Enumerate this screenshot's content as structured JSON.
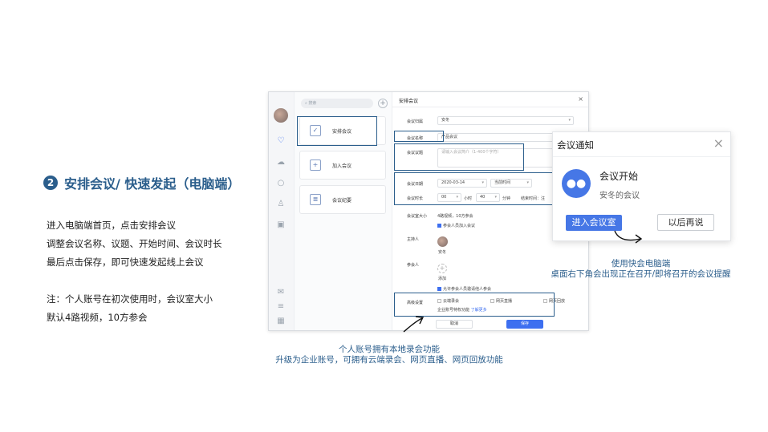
{
  "heading": {
    "number": "2",
    "title": "安排会议/ 快速发起（电脑端）"
  },
  "description": {
    "lines": [
      "进入电脑端首页，点击安排会议",
      "调整会议名称、议题、开始时间、会议时长",
      "最后点击保存，即可快速发起线上会议"
    ],
    "note_lines": [
      "注：个人账号在初次使用时，会议室大小",
      "默认4路视频，10方参会"
    ]
  },
  "app": {
    "search_placeholder": "搜索",
    "cards": [
      {
        "label": "安排会议",
        "icon": "check-calendar-icon"
      },
      {
        "label": "加入会议",
        "icon": "plus-icon"
      },
      {
        "label": "会议纪要",
        "icon": "document-icon"
      }
    ],
    "dialog": {
      "title": "安排会议",
      "close": "×",
      "fields": {
        "type_label": "会议归属",
        "type_value": "安冬",
        "name_label": "会议名称",
        "name_value": "产品会议",
        "topic_label": "会议议题",
        "topic_placeholder": "请输入会议简介（1-400个字符）",
        "date_label": "会议日期",
        "date_value": "2020-03-14",
        "time_value": "当前时间",
        "duration_label": "会议时长",
        "hours_value": "00",
        "hours_unit": "小时",
        "minutes_value": "40",
        "minutes_unit": "分钟",
        "end_label": "结束时间：注",
        "size_label": "会议室大小",
        "size_value": "4路视频，10方参会",
        "host_opt": "参会人员加入会议",
        "host_label": "主持人",
        "host_name": "安冬",
        "attendee_label": "参会人",
        "attendee_add": "添加",
        "allow_opt": "允许参会人员邀请他人参会",
        "adv_label": "高级设置",
        "adv_opt1": "云端录会",
        "adv_opt2": "网页直播",
        "adv_opt3": "网页回放",
        "adv_note": "企业账号特权功能",
        "adv_link": "了解更多"
      },
      "cancel": "取消",
      "save": "保存"
    }
  },
  "notification": {
    "title": "会议通知",
    "close": "×",
    "headline": "会议开始",
    "subtitle": "安冬的会议",
    "join": "进入会议室",
    "later": "以后再说"
  },
  "captions": {
    "right": [
      "使用快会电脑端",
      "桌面右下角会出现正在召开/即将召开的会议提醒"
    ],
    "bottom": [
      "个人账号拥有本地录会功能",
      "升级为企业账号，可拥有云端录会、网页直播、网页回放功能"
    ]
  },
  "colors": {
    "accent": "#2b5e8c",
    "primary": "#4677e6"
  }
}
